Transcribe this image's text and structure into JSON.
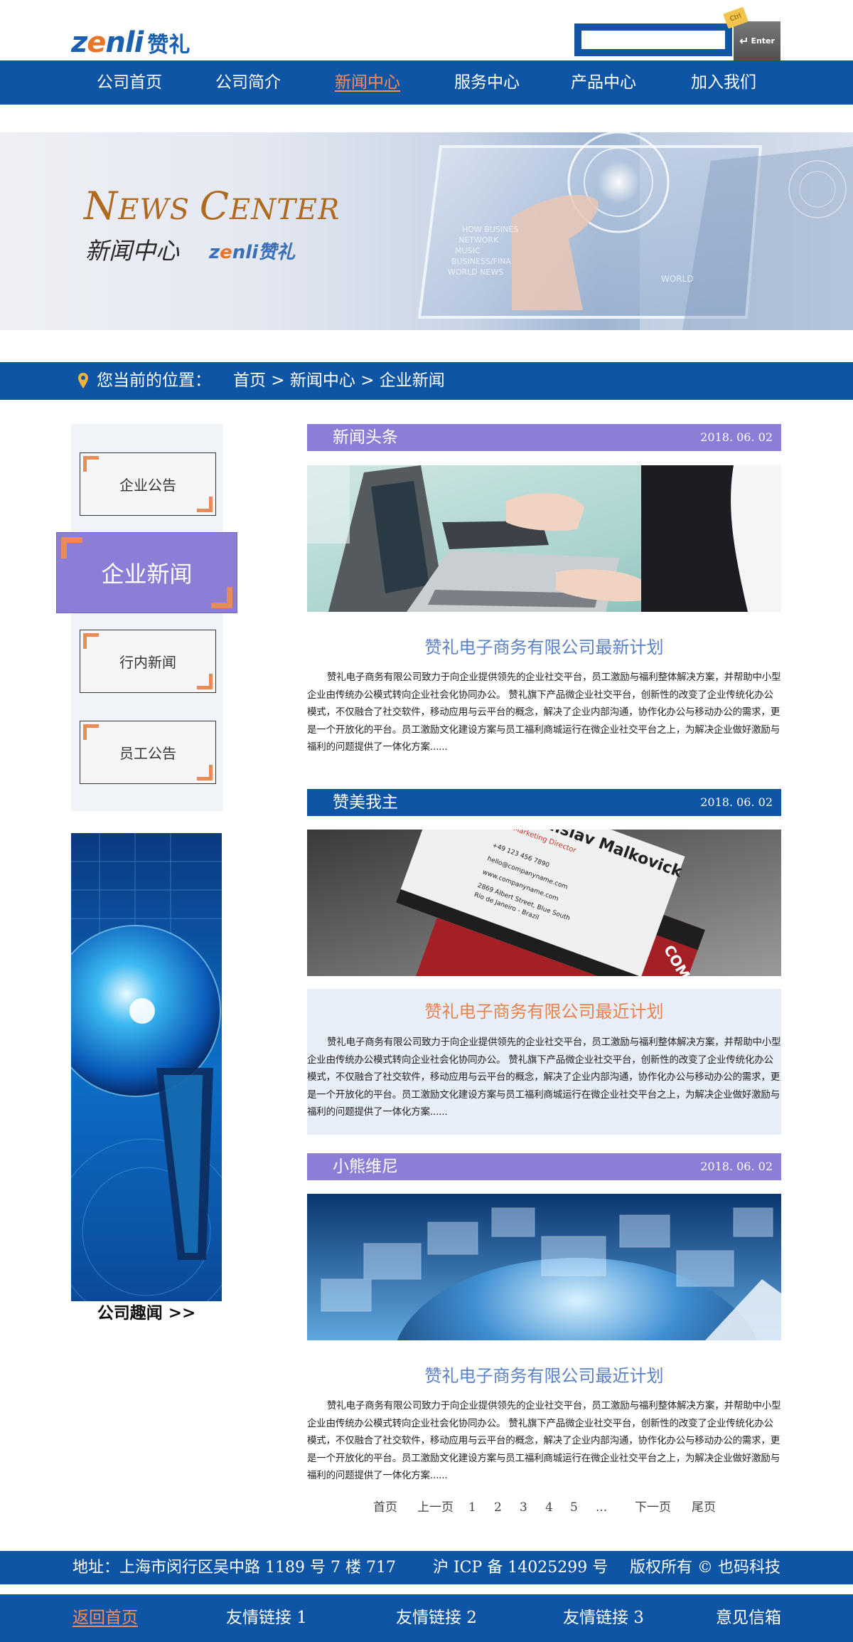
{
  "header": {
    "logo_latin_a": "z",
    "logo_latin_o": "e",
    "logo_latin_b": "nli",
    "logo_cn": "赞礼",
    "search": {
      "value": "",
      "placeholder": ""
    },
    "search_button_label": "Enter",
    "ctrl_tag": "Ctrl"
  },
  "nav": {
    "items": [
      {
        "label": "公司首页"
      },
      {
        "label": "公司简介"
      },
      {
        "label": "新闻中心"
      },
      {
        "label": "服务中心"
      },
      {
        "label": "产品中心"
      },
      {
        "label": "加入我们"
      }
    ],
    "active_index": 2
  },
  "banner": {
    "title_en_big1": "N",
    "title_en_small1": "EWS ",
    "title_en_big2": "C",
    "title_en_small2": "ENTER",
    "title_cn": "新闻中心",
    "logo_latin_a": "z",
    "logo_latin_o": "e",
    "logo_latin_b": "nli",
    "logo_cn": "赞礼"
  },
  "breadcrumb": {
    "label": "您当前的位置：",
    "path": "首页 > 新闻中心 > 企业新闻"
  },
  "sidebar": {
    "items": [
      {
        "label": "企业公告"
      },
      {
        "label": "企业新闻"
      },
      {
        "label": "行内新闻"
      },
      {
        "label": "员工公告"
      }
    ],
    "active_index": 1,
    "ad_caption": "公司趣闻 >>"
  },
  "articles": [
    {
      "category": "新闻头条",
      "date": "2018. 06. 02",
      "title": "赞礼电子商务有限公司最新计划",
      "body": "赞礼电子商务有限公司致力于向企业提供领先的企业社交平台，员工激励与福利整体解决方案，并帮助中小型企业由传统办公模式转向企业社会化协同办公。    赞礼旗下产品微企业社交平台，创新性的改变了企业传统化办公模式，不仅融合了社交软件，移动应用与云平台的概念，解决了企业内部沟通，协作化办公与移动办公的需求，更是一个开放化的平台。员工激励文化建设方案与员工福利商城运行在微企业社交平台之上，为解决企业做好激励与福利的问题提供了一体化方案......"
    },
    {
      "category": "赞美我主",
      "date": "2018. 06. 02",
      "title": "赞礼电子商务有限公司最近计划",
      "card_name": "Vladislav Malkovick",
      "card_role": "Marketing Director",
      "card_lines": [
        "+49 123 456 7890",
        "hello@companyname.com",
        "www.companyname.com",
        "2869 Albert Street, Blue South",
        "Rio de Janeiro - Brazil"
      ],
      "card_brand": "COMPANY",
      "body": "赞礼电子商务有限公司致力于向企业提供领先的企业社交平台，员工激励与福利整体解决方案，并帮助中小型企业由传统办公模式转向企业社会化协同办公。    赞礼旗下产品微企业社交平台，创新性的改变了企业传统化办公模式，不仅融合了社交软件，移动应用与云平台的概念，解决了企业内部沟通，协作化办公与移动办公的需求，更是一个开放化的平台。员工激励文化建设方案与员工福利商城运行在微企业社交平台之上，为解决企业做好激励与福利的问题提供了一体化方案......"
    },
    {
      "category": "小熊维尼",
      "date": "2018. 06. 02",
      "title": "赞礼电子商务有限公司最近计划",
      "body": "赞礼电子商务有限公司致力于向企业提供领先的企业社交平台，员工激励与福利整体解决方案，并帮助中小型企业由传统办公模式转向企业社会化协同办公。    赞礼旗下产品微企业社交平台，创新性的改变了企业传统化办公模式，不仅融合了社交软件，移动应用与云平台的概念，解决了企业内部沟通，协作化办公与移动办公的需求，更是一个开放化的平台。员工激励文化建设方案与员工福利商城运行在微企业社交平台之上，为解决企业做好激励与福利的问题提供了一体化方案......"
    }
  ],
  "pagination": {
    "first": "首页",
    "prev": "上一页",
    "pages": [
      "1",
      "2",
      "3",
      "4",
      "5"
    ],
    "ellipsis": "...",
    "next": "下一页",
    "last": "尾页"
  },
  "footer": {
    "address": "地址：上海市闵行区吴中路 1189 号 7 楼 717",
    "icp": "沪 ICP 备 14025299 号",
    "copyright": "版权所有 © 也码科技",
    "links": [
      {
        "label": "返回首页"
      },
      {
        "label": "友情链接 1"
      },
      {
        "label": "友情链接 2"
      },
      {
        "label": "友情链接 3"
      },
      {
        "label": "意见信箱"
      }
    ]
  },
  "colors": {
    "primary_blue": "#0e55a5",
    "accent_orange": "#ff8a5c",
    "violet": "#8c7ed6",
    "title_blue": "#5b82c6",
    "title_orange": "#e8824d"
  }
}
